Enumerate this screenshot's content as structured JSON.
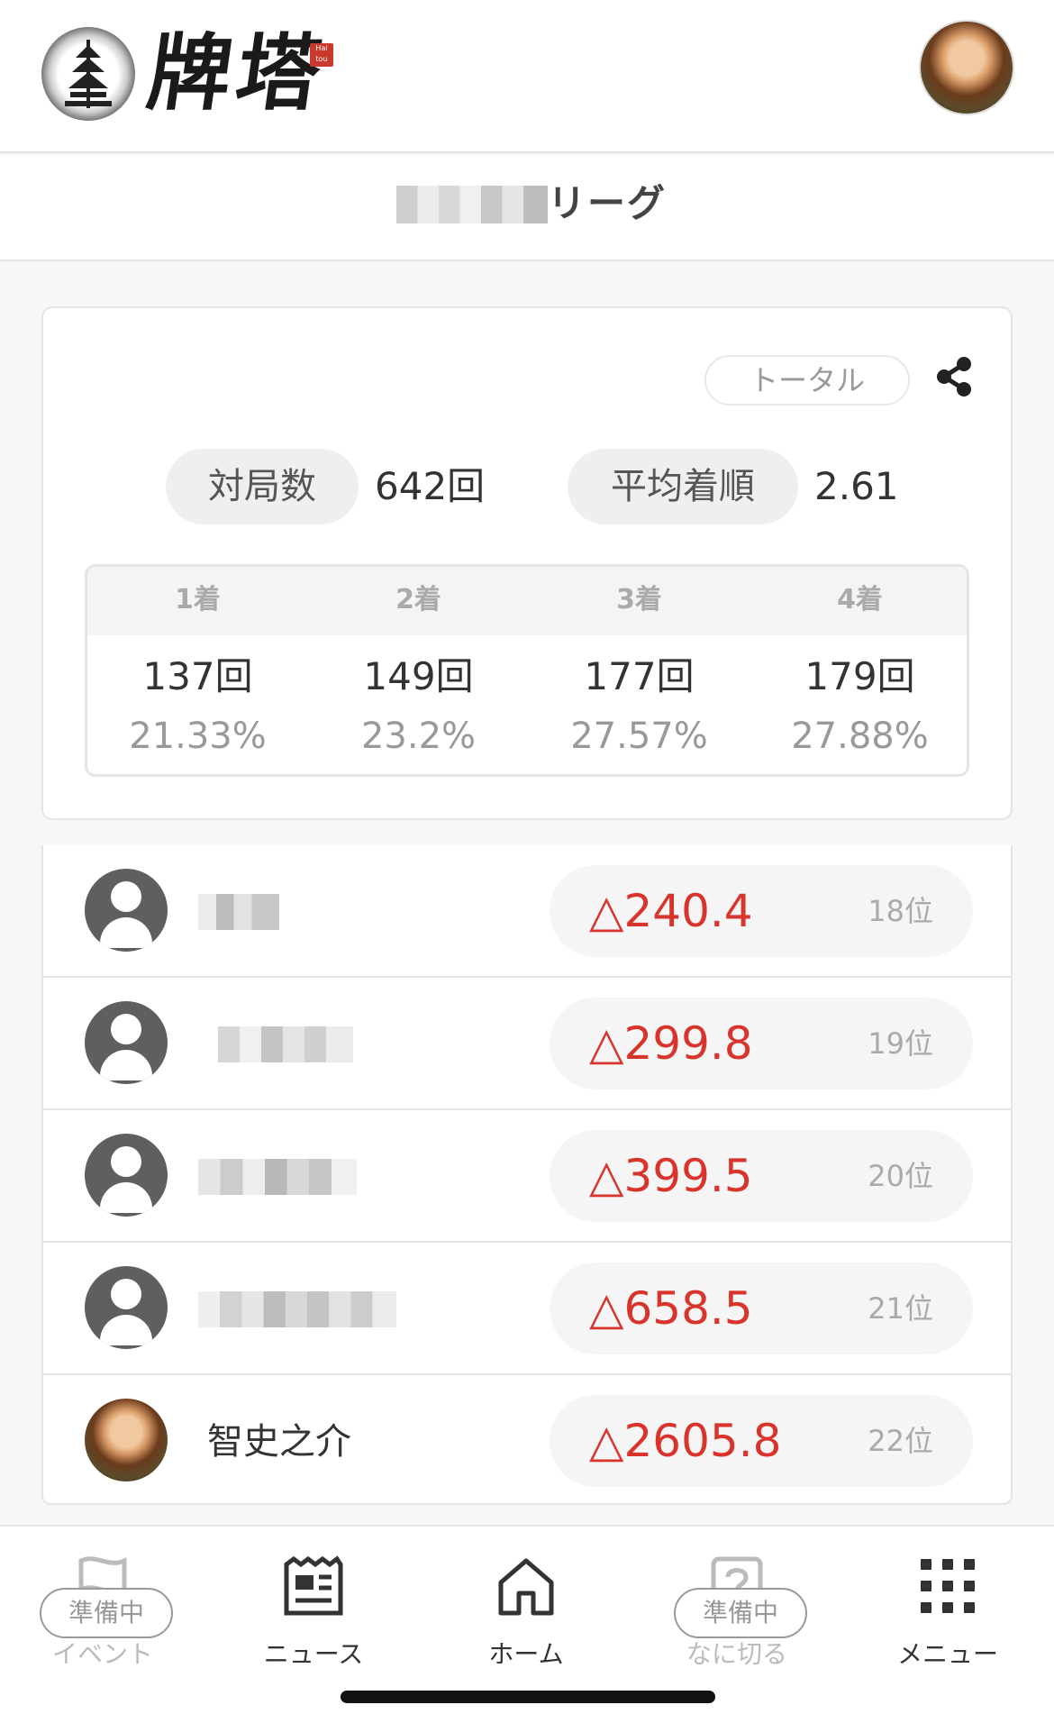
{
  "header": {
    "logo_text": "牌塔",
    "logo_stamp": "Hai tou"
  },
  "league": {
    "title": "リーグ"
  },
  "stats": {
    "filter_label": "トータル",
    "games_label": "対局数",
    "games_value": "642回",
    "avg_label": "平均着順",
    "avg_value": "2.61",
    "places": [
      {
        "label": "1着",
        "count": "137回",
        "pct": "21.33%"
      },
      {
        "label": "2着",
        "count": "149回",
        "pct": "23.2%"
      },
      {
        "label": "3着",
        "count": "177回",
        "pct": "27.57%"
      },
      {
        "label": "4着",
        "count": "179回",
        "pct": "27.88%"
      }
    ]
  },
  "players": [
    {
      "name": "",
      "score": "△240.4",
      "rank": "18位"
    },
    {
      "name": "",
      "score": "△299.8",
      "rank": "19位"
    },
    {
      "name": "",
      "score": "△399.5",
      "rank": "20位"
    },
    {
      "name": "",
      "score": "△658.5",
      "rank": "21位"
    },
    {
      "name": "智史之介",
      "score": "△2605.8",
      "rank": "22位"
    }
  ],
  "nav": {
    "items": [
      {
        "label": "イベント",
        "badge": "準備中",
        "icon": "flag-icon"
      },
      {
        "label": "ニュース",
        "icon": "news-icon"
      },
      {
        "label": "ホーム",
        "icon": "home-icon"
      },
      {
        "label": "なに切る",
        "badge": "準備中",
        "icon": "question-icon"
      },
      {
        "label": "メニュー",
        "icon": "grid-menu-icon"
      }
    ]
  },
  "colors": {
    "score_negative": "#d9342b",
    "pill_bg": "#efefef"
  }
}
